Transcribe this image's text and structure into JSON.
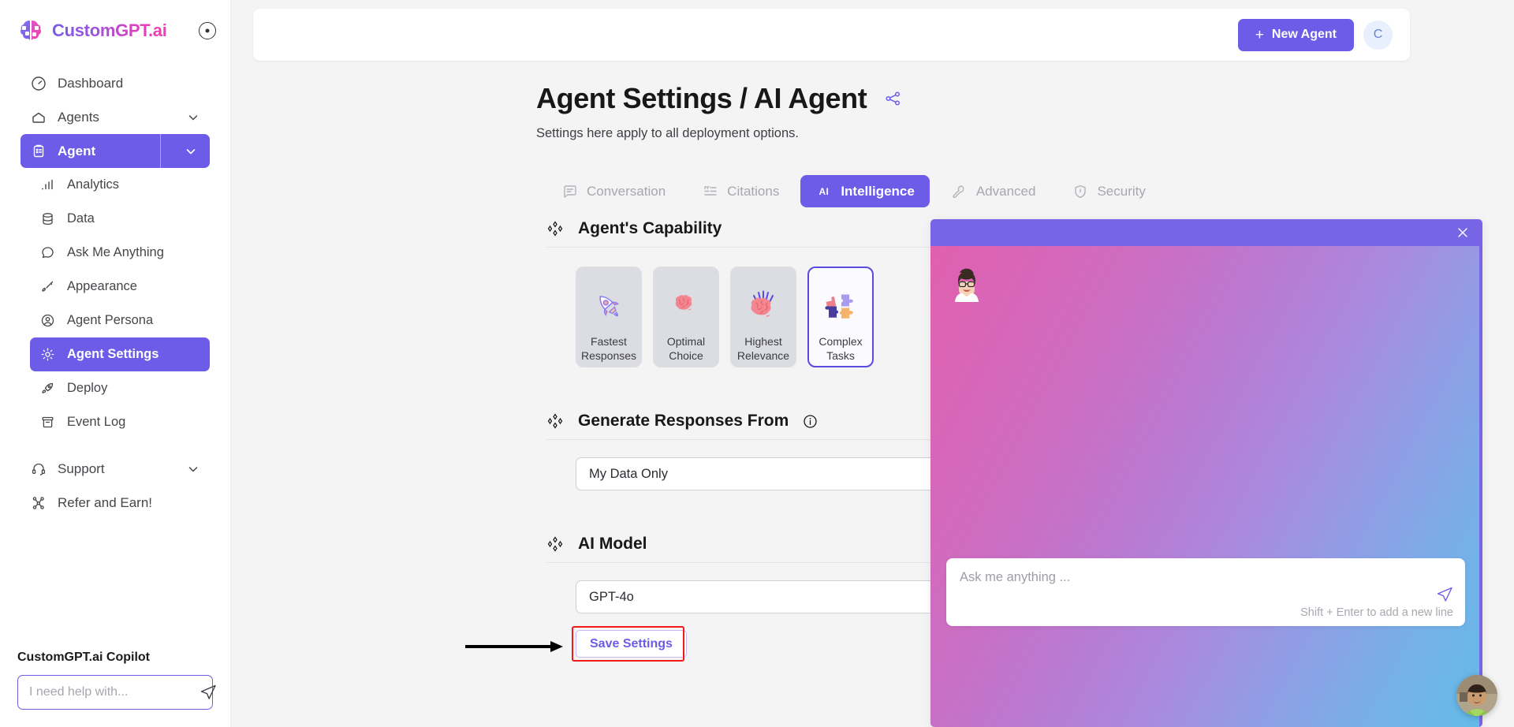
{
  "brand": {
    "name": "CustomGPT.ai",
    "logo_icon": "brain-puzzle-logo",
    "collapse_icon": "collapse-sidebar-icon"
  },
  "sidebar": {
    "items": [
      {
        "label": "Dashboard",
        "icon": "gauge-icon",
        "type": "top"
      },
      {
        "label": "Agents",
        "icon": "home-icon",
        "type": "top",
        "chevron": true
      },
      {
        "label": "Agent",
        "icon": "clipboard-icon",
        "type": "active-split",
        "chevron": true
      },
      {
        "label": "Analytics",
        "icon": "bar-chart-icon",
        "type": "sub"
      },
      {
        "label": "Data",
        "icon": "database-icon",
        "type": "sub"
      },
      {
        "label": "Ask Me Anything",
        "icon": "chat-bubble-icon",
        "type": "sub"
      },
      {
        "label": "Appearance",
        "icon": "paintbrush-icon",
        "type": "sub"
      },
      {
        "label": "Agent Persona",
        "icon": "user-circle-icon",
        "type": "sub"
      },
      {
        "label": "Agent Settings",
        "icon": "gear-icon",
        "type": "sub-active"
      },
      {
        "label": "Deploy",
        "icon": "rocket-icon",
        "type": "sub"
      },
      {
        "label": "Event Log",
        "icon": "archive-icon",
        "type": "sub"
      },
      {
        "label": "Support",
        "icon": "headset-icon",
        "type": "top",
        "chevron": true
      },
      {
        "label": "Refer and Earn!",
        "icon": "share-nodes-icon",
        "type": "top"
      }
    ],
    "copilot": {
      "title": "CustomGPT.ai Copilot",
      "placeholder": "I need help with...",
      "value": "",
      "send_icon": "send-paper-plane-icon"
    }
  },
  "topbar": {
    "new_agent_label": "New Agent",
    "new_agent_plus": "+",
    "avatar_initial": "C"
  },
  "page": {
    "title": "Agent Settings / AI Agent",
    "share_icon": "share-icon",
    "subtitle": "Settings here apply to all deployment options."
  },
  "tabs": [
    {
      "label": "Conversation",
      "icon": "conversation-icon",
      "selected": false
    },
    {
      "label": "Citations",
      "icon": "quote-list-icon",
      "selected": false
    },
    {
      "label": "Intelligence",
      "icon": "AI",
      "selected": true
    },
    {
      "label": "Advanced",
      "icon": "wrench-icon",
      "selected": false
    },
    {
      "label": "Security",
      "icon": "shield-lock-icon",
      "selected": false
    }
  ],
  "capability": {
    "heading": "Agent's Capability",
    "options": [
      {
        "label": "Fastest Responses",
        "icon": "rocket-art",
        "selected": false
      },
      {
        "label": "Optimal Choice",
        "icon": "brain-art",
        "selected": false
      },
      {
        "label": "Highest Relevance",
        "icon": "brain-rays-art",
        "selected": false
      },
      {
        "label": "Complex Tasks",
        "icon": "puzzle-art",
        "selected": true
      }
    ]
  },
  "generate_responses": {
    "heading": "Generate Responses From",
    "info_icon": "info-icon",
    "selected": "My Data Only",
    "options": [
      "My Data Only"
    ]
  },
  "ai_model": {
    "heading": "AI Model",
    "selected": "GPT-4o",
    "options": [
      "GPT-4o"
    ]
  },
  "save": {
    "label": "Save Settings",
    "highlight_color": "#ef1b1b",
    "annotation_icon": "arrow-pointer-annotation"
  },
  "chat_widget": {
    "close_icon": "close-icon",
    "header_color": "#7765e6",
    "avatar_icon": "agent-avatar",
    "input_placeholder": "Ask me anything ...",
    "hint": "Shift + Enter to add a new line",
    "send_icon": "send-paper-plane-icon"
  },
  "floating": {
    "avatar_icon": "support-person-avatar"
  }
}
